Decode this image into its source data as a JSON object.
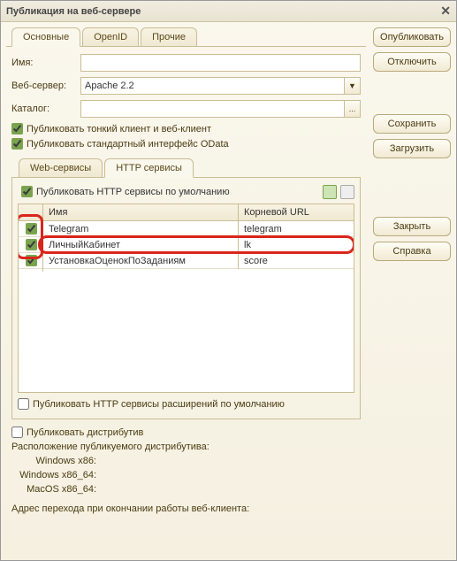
{
  "title": "Публикация на веб-сервере",
  "tabs": {
    "main": "Основные",
    "openid": "OpenID",
    "other": "Прочие"
  },
  "form": {
    "name_label": "Имя:",
    "name_value": "",
    "webserver_label": "Веб-сервер:",
    "webserver_value": "Apache 2.2",
    "catalog_label": "Каталог:",
    "catalog_value": "",
    "catalog_btn": "..."
  },
  "checks": {
    "thin": "Публиковать тонкий клиент и веб-клиент",
    "odata": "Публиковать стандартный интерфейс OData"
  },
  "subtabs": {
    "ws": "Web-сервисы",
    "http": "HTTP сервисы"
  },
  "http": {
    "default_label": "Публиковать HTTP сервисы по умолчанию",
    "col_name": "Имя",
    "col_url": "Корневой URL",
    "rows": [
      {
        "name": "Telegram",
        "url": "telegram"
      },
      {
        "name": "ЛичныйКабинет",
        "url": "lk"
      },
      {
        "name": "УстановкаОценокПоЗаданиям",
        "url": "score"
      }
    ],
    "ext_label": "Публиковать HTTP сервисы расширений по умолчанию"
  },
  "dist": {
    "publish_label": "Публиковать дистрибутив",
    "location_label": "Расположение публикуемого дистрибутива:",
    "winx86": "Windows x86:",
    "winx64": "Windows x86_64:",
    "mac": "MacOS x86_64:"
  },
  "footer_label": "Адрес перехода при окончании работы веб-клиента:",
  "buttons": {
    "publish": "Опубликовать",
    "disconnect": "Отключить",
    "save": "Сохранить",
    "load": "Загрузить",
    "close": "Закрыть",
    "help": "Справка"
  }
}
